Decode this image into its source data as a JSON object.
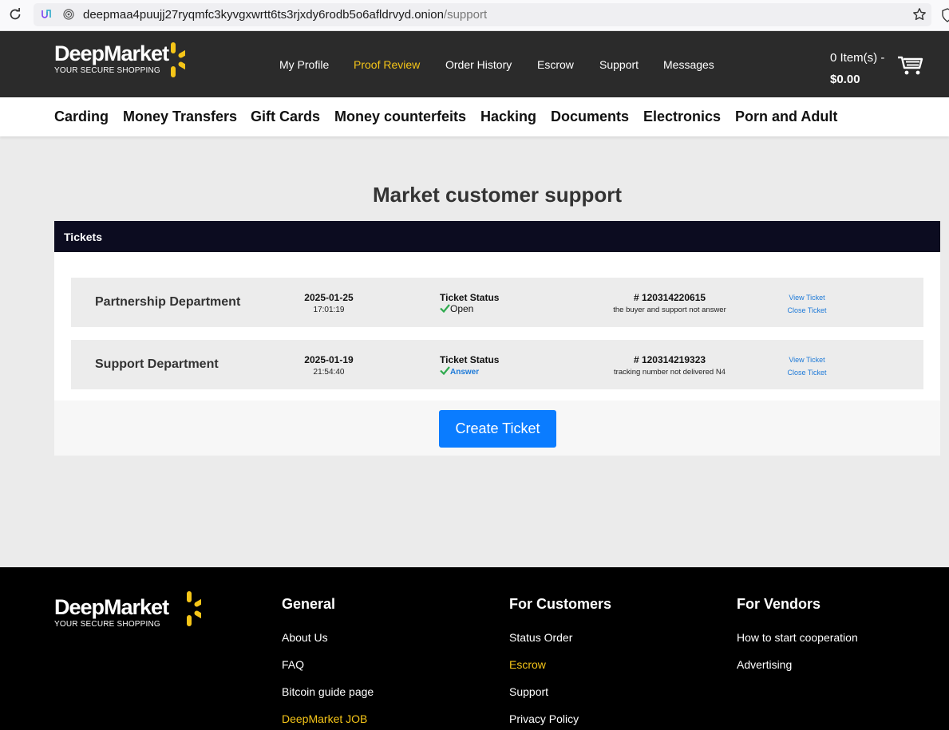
{
  "browser": {
    "url_host": "deepmaa4puujj27ryqmfc3kyvgxwrtt6ts3rjxdy6rodb5o6afldrvyd.onion",
    "url_path": "/support"
  },
  "brand": {
    "name": "DeepMarket",
    "tagline": "YOUR SECURE SHOPPING"
  },
  "topnav": [
    {
      "label": "My Profile",
      "active": false
    },
    {
      "label": "Proof Review",
      "active": true
    },
    {
      "label": "Order History",
      "active": false
    },
    {
      "label": "Escrow",
      "active": false
    },
    {
      "label": "Support",
      "active": false
    },
    {
      "label": "Messages",
      "active": false
    }
  ],
  "cart": {
    "items": "0 Item(s) -",
    "total": "$0.00"
  },
  "categories": [
    "Carding",
    "Money Transfers",
    "Gift Cards",
    "Money counterfeits",
    "Hacking",
    "Documents",
    "Electronics",
    "Porn and Adult"
  ],
  "main": {
    "title": "Market customer support",
    "panel_title": "Tickets",
    "status_label": "Ticket Status",
    "view_label": "View Ticket",
    "close_label": "Close Ticket",
    "create_button": "Create Ticket"
  },
  "tickets": [
    {
      "department": "Partnership Department",
      "date": "2025-01-25",
      "time": "17:01:19",
      "status": "Open",
      "number": "# 120314220615",
      "description": "the buyer and support not answer"
    },
    {
      "department": "Support Department",
      "date": "2025-01-19",
      "time": "21:54:40",
      "status": "Answer",
      "number": "# 120314219323",
      "description": "tracking number not delivered N4"
    }
  ],
  "footer": {
    "general": {
      "title": "General",
      "links": [
        {
          "label": "About Us",
          "highlight": false
        },
        {
          "label": "FAQ",
          "highlight": false
        },
        {
          "label": "Bitcoin guide page",
          "highlight": false
        },
        {
          "label": "DeepMarket JOB",
          "highlight": true
        }
      ]
    },
    "customers": {
      "title": "For Customers",
      "links": [
        {
          "label": "Status Order",
          "highlight": false
        },
        {
          "label": "Escrow",
          "highlight": true
        },
        {
          "label": "Support",
          "highlight": false
        },
        {
          "label": "Privacy Policy",
          "highlight": false
        }
      ]
    },
    "vendors": {
      "title": "For Vendors",
      "links": [
        {
          "label": "How to start cooperation",
          "highlight": false
        },
        {
          "label": "Advertising",
          "highlight": false
        }
      ]
    }
  },
  "colors": {
    "accent_yellow": "#f5c518",
    "header_bg": "#2b2b2b",
    "panel_head_bg": "#0c0c20",
    "button_blue": "#0a7cff",
    "link_blue": "#1e7ad8",
    "check_green": "#2eaa4e"
  }
}
